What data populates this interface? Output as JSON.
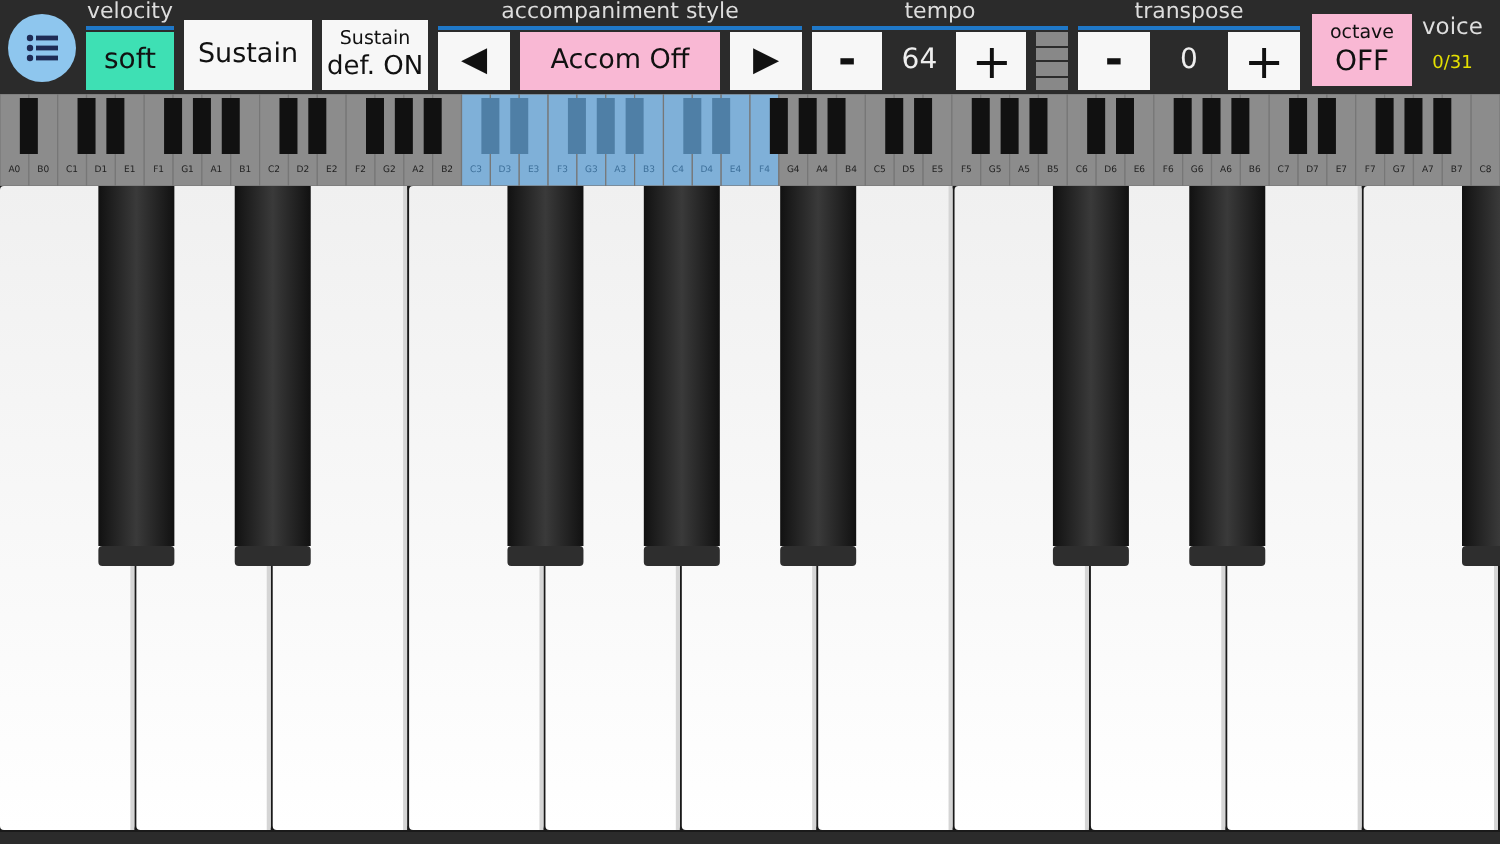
{
  "toolbar": {
    "velocity": {
      "label": "velocity",
      "value": "soft"
    },
    "sustain": {
      "label": "Sustain"
    },
    "sustain_default": {
      "label": "Sustain",
      "value": "def. ON"
    },
    "accompaniment": {
      "label": "accompaniment style",
      "prev": "◀",
      "value": "Accom Off",
      "next": "▶"
    },
    "tempo": {
      "label": "tempo",
      "minus": "-",
      "value": "64",
      "plus": "+"
    },
    "transpose": {
      "label": "transpose",
      "minus": "-",
      "value": "0",
      "plus": "+"
    },
    "octave": {
      "label": "octave",
      "value": "OFF"
    },
    "voice": {
      "label": "voice",
      "value": "0/31"
    }
  },
  "mini_keyboard": {
    "keys": [
      {
        "label": "A0",
        "selected": false
      },
      {
        "label": "B0",
        "selected": false
      },
      {
        "label": "C1",
        "selected": false
      },
      {
        "label": "D1",
        "selected": false
      },
      {
        "label": "E1",
        "selected": false
      },
      {
        "label": "F1",
        "selected": false
      },
      {
        "label": "G1",
        "selected": false
      },
      {
        "label": "A1",
        "selected": false
      },
      {
        "label": "B1",
        "selected": false
      },
      {
        "label": "C2",
        "selected": false
      },
      {
        "label": "D2",
        "selected": false
      },
      {
        "label": "E2",
        "selected": false
      },
      {
        "label": "F2",
        "selected": false
      },
      {
        "label": "G2",
        "selected": false
      },
      {
        "label": "A2",
        "selected": false
      },
      {
        "label": "B2",
        "selected": false
      },
      {
        "label": "C3",
        "selected": true
      },
      {
        "label": "D3",
        "selected": true
      },
      {
        "label": "E3",
        "selected": true
      },
      {
        "label": "F3",
        "selected": true
      },
      {
        "label": "G3",
        "selected": true
      },
      {
        "label": "A3",
        "selected": true
      },
      {
        "label": "B3",
        "selected": true
      },
      {
        "label": "C4",
        "selected": true
      },
      {
        "label": "D4",
        "selected": true
      },
      {
        "label": "E4",
        "selected": true
      },
      {
        "label": "F4",
        "selected": true
      },
      {
        "label": "G4",
        "selected": false
      },
      {
        "label": "A4",
        "selected": false
      },
      {
        "label": "B4",
        "selected": false
      },
      {
        "label": "C5",
        "selected": false
      },
      {
        "label": "D5",
        "selected": false
      },
      {
        "label": "E5",
        "selected": false
      },
      {
        "label": "F5",
        "selected": false
      },
      {
        "label": "G5",
        "selected": false
      },
      {
        "label": "A5",
        "selected": false
      },
      {
        "label": "B5",
        "selected": false
      },
      {
        "label": "C6",
        "selected": false
      },
      {
        "label": "D6",
        "selected": false
      },
      {
        "label": "E6",
        "selected": false
      },
      {
        "label": "F6",
        "selected": false
      },
      {
        "label": "G6",
        "selected": false
      },
      {
        "label": "A6",
        "selected": false
      },
      {
        "label": "B6",
        "selected": false
      },
      {
        "label": "C7",
        "selected": false
      },
      {
        "label": "D7",
        "selected": false
      },
      {
        "label": "E7",
        "selected": false
      },
      {
        "label": "F7",
        "selected": false
      },
      {
        "label": "G7",
        "selected": false
      },
      {
        "label": "A7",
        "selected": false
      },
      {
        "label": "B7",
        "selected": false
      },
      {
        "label": "C8",
        "selected": false
      }
    ]
  }
}
